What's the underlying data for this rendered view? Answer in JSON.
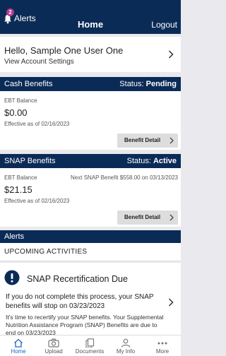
{
  "header": {
    "alerts_badge": "2",
    "alerts_label": "Alerts",
    "title": "Home",
    "logout_label": "Logout"
  },
  "account": {
    "greeting": "Hello, Sample One User One",
    "settings_link": "View Account Settings"
  },
  "cash": {
    "title": "Cash Benefits",
    "status_label": "Status:",
    "status_value": "Pending",
    "balance_label": "EBT Balance",
    "balance": "$0.00",
    "effective": "Effective as of 02/16/2023",
    "detail_button": "Benefit Detail"
  },
  "snap": {
    "title": "SNAP Benefits",
    "status_label": "Status:",
    "status_value": "Active",
    "balance_label": "EBT Balance",
    "next_benefit": "Next SNAP Benefit $558.00 on 03/13/2023",
    "balance": "$21.15",
    "effective": "Effective as of 02/16/2023",
    "detail_button": "Benefit Detail"
  },
  "alerts_section": {
    "title": "Alerts",
    "upcoming": "UPCOMING ACTIVITIES",
    "recert_title": "SNAP Recertification Due",
    "recert_body": "If you do not complete this process, your SNAP benefits will stop on 03/23/2023",
    "recert_detail": "It's time to recertify your SNAP benefits. Your Supplemental Nutrition Assistance Program (SNAP) Benefits are due to end on 03/23/2023"
  },
  "tabs": [
    {
      "label": "Home",
      "icon": "home-icon",
      "active": true
    },
    {
      "label": "Upload",
      "icon": "camera-icon",
      "active": false
    },
    {
      "label": "Documents",
      "icon": "documents-icon",
      "active": false
    },
    {
      "label": "My Info",
      "icon": "person-icon",
      "active": false
    },
    {
      "label": "More",
      "icon": "more-dots-icon",
      "active": false
    }
  ],
  "colors": {
    "header": "#0b2b57",
    "active_tab": "#1b67c4",
    "badge": "#b23a8f"
  }
}
